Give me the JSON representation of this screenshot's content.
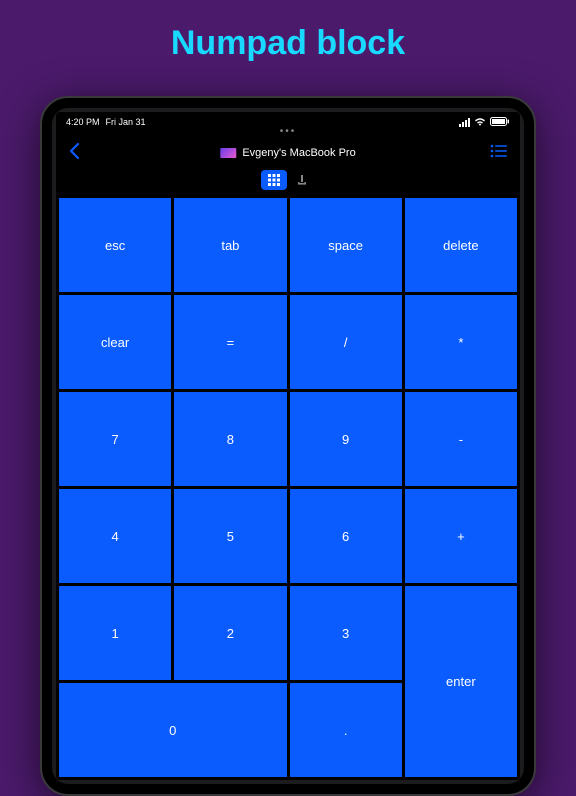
{
  "promo": {
    "title": "Numpad block"
  },
  "status": {
    "time": "4:20 PM",
    "date": "Fri Jan 31"
  },
  "nav": {
    "title": "Evgeny's MacBook Pro"
  },
  "keys": {
    "r1c1": "esc",
    "r1c2": "tab",
    "r1c3": "space",
    "r1c4": "delete",
    "r2c1": "clear",
    "r2c2": "=",
    "r2c3": "/",
    "r2c4": "*",
    "r3c1": "7",
    "r3c2": "8",
    "r3c3": "9",
    "r3c4": "-",
    "r4c1": "4",
    "r4c2": "5",
    "r4c3": "6",
    "r4c4": "+",
    "r5c1": "1",
    "r5c2": "2",
    "r5c3": "3",
    "r6c1": "0",
    "r6c3": ".",
    "enter": "enter"
  }
}
